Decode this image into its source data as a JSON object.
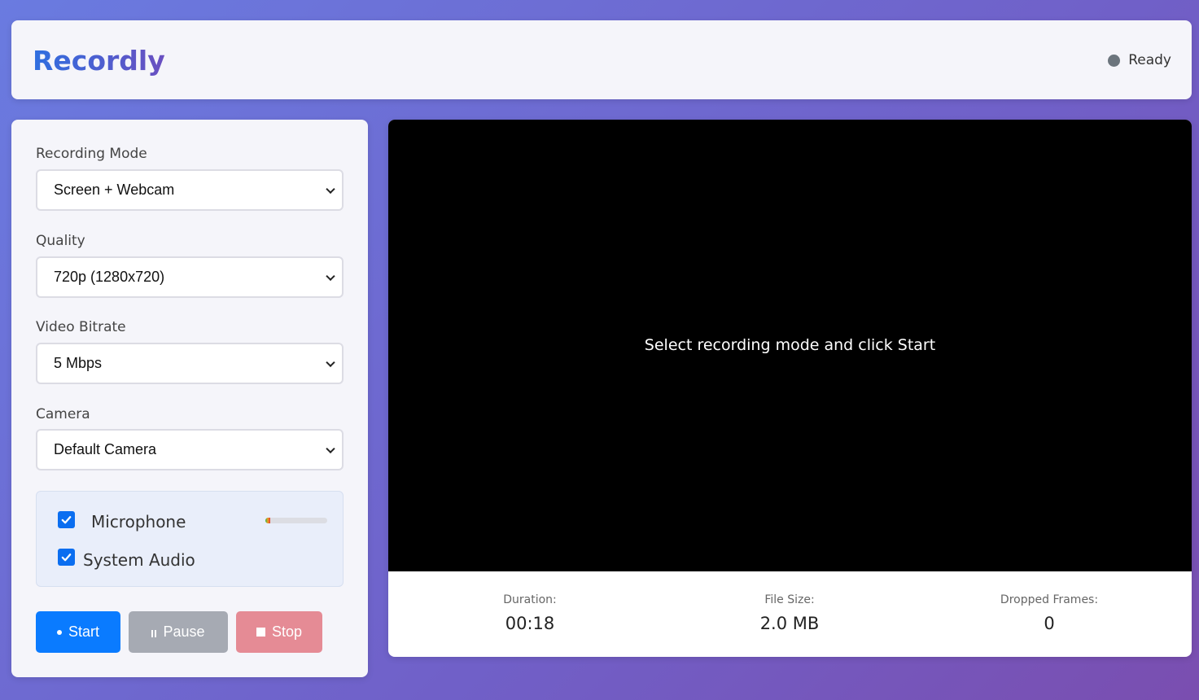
{
  "app": {
    "title": "Recordly"
  },
  "status": {
    "text": "Ready",
    "color": "#6c757d"
  },
  "settings": {
    "recording_mode": {
      "label": "Recording Mode",
      "value": "Screen + Webcam"
    },
    "quality": {
      "label": "Quality",
      "value": "720p (1280x720)"
    },
    "bitrate": {
      "label": "Video Bitrate",
      "value": "5 Mbps"
    },
    "camera": {
      "label": "Camera",
      "value": "Default Camera"
    }
  },
  "audio": {
    "microphone": {
      "label": "Microphone",
      "checked": true,
      "level": 0.08
    },
    "system_audio": {
      "label": "System Audio",
      "checked": true
    }
  },
  "controls": {
    "start": {
      "label": "Start",
      "icon": "record-dot-icon",
      "color": "#0a7bff"
    },
    "pause": {
      "label": "Pause",
      "icon": "pause-icon",
      "color": "#a6aab3"
    },
    "stop": {
      "label": "Stop",
      "icon": "stop-square-icon",
      "color": "#e58b95"
    }
  },
  "preview": {
    "message": "Select recording mode and click Start"
  },
  "stats": {
    "duration": {
      "label": "Duration:",
      "value": "00:18"
    },
    "file_size": {
      "label": "File Size:",
      "value": "2.0 MB"
    },
    "dropped_frames": {
      "label": "Dropped Frames:",
      "value": "0"
    }
  }
}
